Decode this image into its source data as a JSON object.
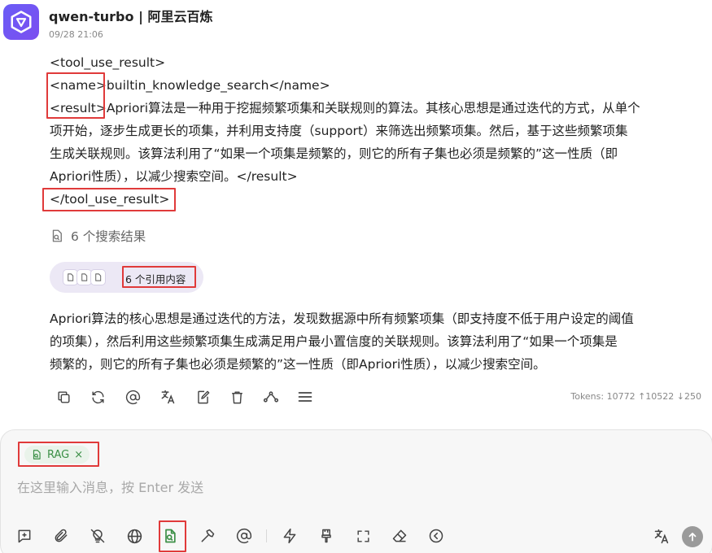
{
  "message": {
    "model_name": "qwen-turbo | 阿里云百炼",
    "timestamp": "09/28 21:06",
    "tool_result_lines": [
      "<tool_use_result>",
      "<name>builtin_knowledge_search</name>",
      "<result>Apriori算法是一种用于挖掘频繁项集和关联规则的算法。其核心思想是通过迭代的方式，从单个",
      "项开始，逐步生成更长的项集，并利用支持度（support）来筛选出频繁项集。然后，基于这些频繁项集",
      "生成关联规则。该算法利用了“如果一个项集是频繁的，则它的所有子集也必须是频繁的”这一性质（即",
      "Apriori性质），以减少搜索空间。</result>",
      "</tool_use_result>"
    ],
    "search_results_label": "6 个搜索结果",
    "citations_label": "6 个引用内容",
    "answer_lines": [
      "Apriori算法的核心思想是通过迭代的方法，发现数据源中所有频繁项集（即支持度不低于用户设定的阈值",
      "的项集），然后利用这些频繁项集生成满足用户最小置信度的关联规则。该算法利用了“如果一个项集是",
      "频繁的，则它的所有子集也必须是频繁的”这一性质（即Apriori性质），以减少搜索空间。"
    ],
    "actions": [
      "copy-icon",
      "regenerate-icon",
      "mention-icon",
      "translate-icon",
      "edit-icon",
      "delete-icon",
      "branch-icon",
      "menu-icon"
    ],
    "tokens": "Tokens: 10772 ↑10522 ↓250"
  },
  "composer": {
    "tag_label": "RAG",
    "tag_close": "×",
    "placeholder": "在这里输入消息，按 Enter 发送",
    "toolbar_icons": [
      "new-topic-icon",
      "attachment-icon",
      "thinking-icon",
      "web-search-icon",
      "knowledge-base-icon",
      "mcp-tools-icon",
      "mention-models-icon",
      "quick-phrases-icon",
      "clear-format-icon",
      "fullscreen-icon",
      "clear-context-icon",
      "collapse-icon",
      "translate-input-icon",
      "send-icon"
    ]
  },
  "colors": {
    "accent": "#6a5cf6",
    "highlight_box": "#e03a3a",
    "rag_green": "#3b8f46",
    "citation_pill": "#ece8f5"
  }
}
